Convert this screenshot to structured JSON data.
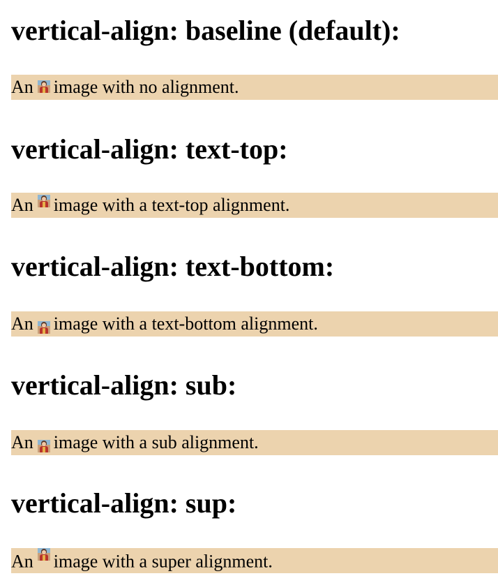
{
  "sections": [
    {
      "heading": "vertical-align: baseline (default):",
      "text_before": "An",
      "text_after": "image with no alignment."
    },
    {
      "heading": "vertical-align: text-top:",
      "text_before": "An",
      "text_after": "image with a text-top alignment."
    },
    {
      "heading": "vertical-align: text-bottom:",
      "text_before": "An",
      "text_after": "image with a text-bottom alignment."
    },
    {
      "heading": "vertical-align: sub:",
      "text_before": "An",
      "text_after": "image with a sub alignment."
    },
    {
      "heading": "vertical-align: sup:",
      "text_before": "An",
      "text_after": "image with a super alignment."
    }
  ],
  "colors": {
    "demo_background": "#ecd3ae",
    "text": "#000000",
    "page_background": "#ffffff"
  },
  "icons": {
    "thumbnail": "portrait-image-icon"
  }
}
